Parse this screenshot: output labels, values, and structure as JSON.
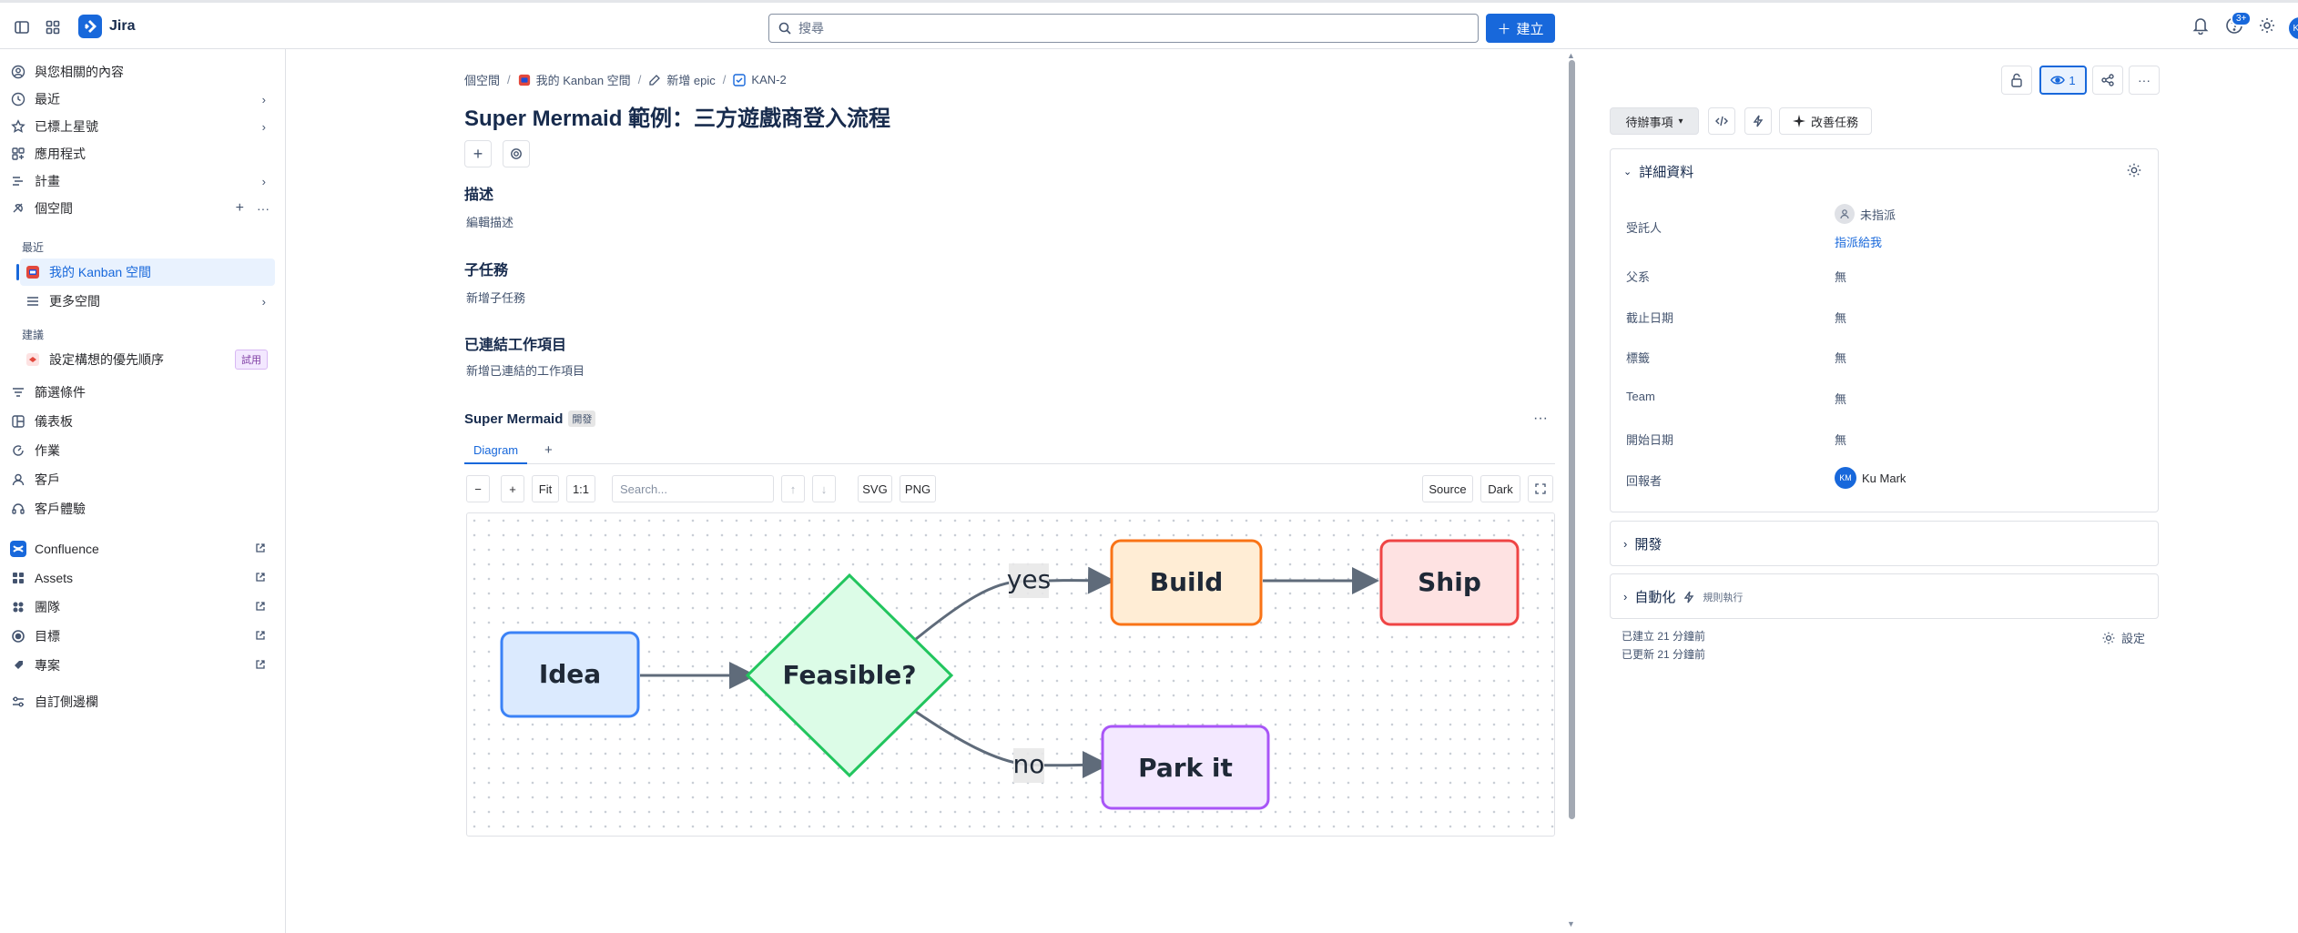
{
  "app": {
    "name": "Jira"
  },
  "topbar": {
    "search_placeholder": "搜尋",
    "create_label": "建立",
    "notification_badge": "3+",
    "avatar_initials": "KM"
  },
  "sidebar": {
    "items": [
      {
        "label": "與您相關的內容",
        "icon": "user-circle-icon"
      },
      {
        "label": "最近",
        "icon": "clock-icon"
      },
      {
        "label": "已標上星號",
        "icon": "star-icon"
      },
      {
        "label": "應用程式",
        "icon": "apps-icon"
      },
      {
        "label": "計畫",
        "icon": "plan-icon"
      },
      {
        "label": "個空間",
        "icon": "spaces-icon"
      }
    ],
    "recent_heading": "最近",
    "selected_space": "我的 Kanban 空間",
    "more_spaces": "更多空間",
    "recommended_heading": "建議",
    "recommend_item": "設定構想的優先順序",
    "try_badge": "試用",
    "items2": [
      {
        "label": "篩選條件",
        "icon": "filter-icon"
      },
      {
        "label": "儀表板",
        "icon": "dashboard-icon"
      },
      {
        "label": "作業",
        "icon": "operations-icon"
      },
      {
        "label": "客戶",
        "icon": "customer-icon"
      },
      {
        "label": "客戶體驗",
        "icon": "headset-icon"
      }
    ],
    "apps": [
      {
        "label": "Confluence",
        "icon": "confluence-icon"
      },
      {
        "label": "Assets",
        "icon": "assets-icon"
      },
      {
        "label": "團隊",
        "icon": "teams-icon"
      },
      {
        "label": "目標",
        "icon": "goals-icon"
      },
      {
        "label": "專案",
        "icon": "projects-icon"
      }
    ],
    "customize": "自訂側邊欄"
  },
  "main": {
    "breadcrumb": [
      "個空間",
      "我的 Kanban 空間",
      "新增 epic",
      "KAN-2"
    ],
    "title": "Super Mermaid 範例：三方遊戲商登入流程",
    "description_heading": "描述",
    "description_placeholder": "編輯描述",
    "subtasks_heading": "子任務",
    "subtasks_add": "新增子任務",
    "linked_heading": "已連結工作項目",
    "linked_add": "新增已連結的工作項目"
  },
  "mermaid": {
    "title": "Super Mermaid",
    "badge": "開發",
    "tab_diagram": "Diagram",
    "tab_add": "+",
    "toolbar": {
      "zoom_out": "−",
      "zoom_in": "+",
      "fit": "Fit",
      "one_to_one": "1:1",
      "search_placeholder": "Search...",
      "up": "↑",
      "down": "↓",
      "svg": "SVG",
      "png": "PNG",
      "source": "Source",
      "dark": "Dark"
    },
    "diagram": {
      "nodes": {
        "idea": "Idea",
        "feasible": "Feasible?",
        "build": "Build",
        "ship": "Ship",
        "park": "Park it"
      },
      "edges": {
        "yes": "yes",
        "no": "no"
      },
      "colors": {
        "idea_fill": "#dbeafe",
        "idea_stroke": "#3b82f6",
        "feasible_fill": "#dcfce7",
        "feasible_stroke": "#22c55e",
        "build_fill": "#ffedd5",
        "build_stroke": "#f97316",
        "ship_fill": "#fee2e2",
        "ship_stroke": "#ef4444",
        "park_fill": "#f3e8ff",
        "park_stroke": "#a855f7",
        "edge": "#5f6b7a"
      }
    }
  },
  "right": {
    "watch_count": "1",
    "status": "待辦事項",
    "improve": "改善任務",
    "details_heading": "詳細資料",
    "fields": {
      "assignee_label": "受託人",
      "assignee_value": "未指派",
      "assign_me": "指派給我",
      "parent_label": "父系",
      "parent_value": "無",
      "due_label": "截止日期",
      "due_value": "無",
      "labels_label": "標籤",
      "labels_value": "無",
      "team_label": "Team",
      "team_value": "無",
      "start_label": "開始日期",
      "start_value": "無",
      "reporter_label": "回報者",
      "reporter_initials": "KM",
      "reporter_value": "Ku Mark"
    },
    "dev_heading": "開發",
    "automation_heading": "自動化",
    "automation_sub": "規則執行",
    "created": "已建立 21 分鐘前",
    "updated": "已更新 21 分鐘前",
    "configure": "設定"
  }
}
